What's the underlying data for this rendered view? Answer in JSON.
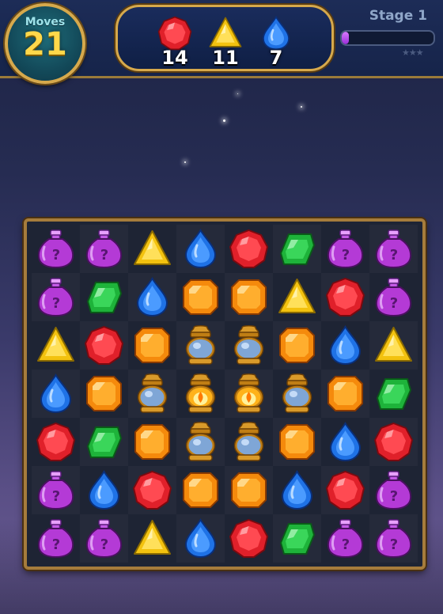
{
  "hud": {
    "moves_label": "Moves",
    "moves_value": "21",
    "stage_label": "Stage 1",
    "progress_fraction": 0.08,
    "stars_total": 3,
    "stars_earned": 0,
    "goals": [
      {
        "piece": "red-gem",
        "count": "14"
      },
      {
        "piece": "yellow-gem",
        "count": "11"
      },
      {
        "piece": "blue-gem",
        "count": "7"
      }
    ]
  },
  "board": {
    "rows": 7,
    "cols": 8,
    "grid": [
      [
        "mystery-potion",
        "mystery-potion",
        "yellow-gem",
        "blue-gem",
        "red-gem",
        "green-gem",
        "mystery-potion",
        "mystery-potion"
      ],
      [
        "mystery-potion",
        "green-gem",
        "blue-gem",
        "orange-gem",
        "orange-gem",
        "yellow-gem",
        "red-gem",
        "mystery-potion"
      ],
      [
        "yellow-gem",
        "red-gem",
        "orange-gem",
        "lantern",
        "lantern",
        "orange-gem",
        "blue-gem",
        "yellow-gem"
      ],
      [
        "blue-gem",
        "orange-gem",
        "lantern",
        "lit-lantern",
        "lit-lantern",
        "lantern",
        "orange-gem",
        "green-gem"
      ],
      [
        "red-gem",
        "green-gem",
        "orange-gem",
        "lantern",
        "lantern",
        "orange-gem",
        "blue-gem",
        "red-gem"
      ],
      [
        "mystery-potion",
        "blue-gem",
        "red-gem",
        "orange-gem",
        "orange-gem",
        "blue-gem",
        "red-gem",
        "mystery-potion"
      ],
      [
        "mystery-potion",
        "mystery-potion",
        "yellow-gem",
        "blue-gem",
        "red-gem",
        "green-gem",
        "mystery-potion",
        "mystery-potion"
      ]
    ]
  },
  "colors": {
    "red": "#e0202a",
    "yellow": "#f3c20f",
    "blue": "#1f72e6",
    "green": "#1eb33a",
    "orange": "#f58a0c",
    "purple": "#b43ad6",
    "gold": "#d6a94c"
  }
}
